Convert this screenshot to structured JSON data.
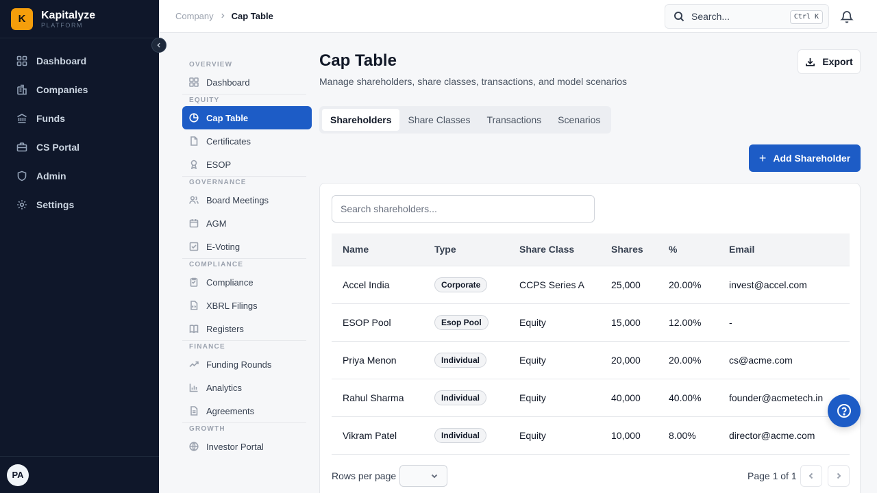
{
  "brand": {
    "logo_letter": "K",
    "name": "Kapitalyze",
    "sub": "PLATFORM"
  },
  "main_nav": [
    {
      "label": "Dashboard",
      "icon": "dashboard-icon"
    },
    {
      "label": "Companies",
      "icon": "building-icon"
    },
    {
      "label": "Funds",
      "icon": "bank-icon"
    },
    {
      "label": "CS Portal",
      "icon": "briefcase-icon"
    },
    {
      "label": "Admin",
      "icon": "shield-icon"
    },
    {
      "label": "Settings",
      "icon": "gear-icon"
    }
  ],
  "user": {
    "initials": "PA"
  },
  "breadcrumb": {
    "parent": "Company",
    "current": "Cap Table"
  },
  "search": {
    "placeholder": "Search...",
    "shortcut": "Ctrl K"
  },
  "subnav": {
    "sections": [
      {
        "title": "OVERVIEW",
        "items": [
          {
            "label": "Dashboard",
            "icon": "grid-icon"
          }
        ]
      },
      {
        "title": "EQUITY",
        "items": [
          {
            "label": "Cap Table",
            "icon": "pie-chart-icon",
            "active": true
          },
          {
            "label": "Certificates",
            "icon": "file-icon"
          },
          {
            "label": "ESOP",
            "icon": "award-icon"
          }
        ]
      },
      {
        "title": "GOVERNANCE",
        "items": [
          {
            "label": "Board Meetings",
            "icon": "users-icon"
          },
          {
            "label": "AGM",
            "icon": "calendar-icon"
          },
          {
            "label": "E-Voting",
            "icon": "vote-icon"
          }
        ]
      },
      {
        "title": "COMPLIANCE",
        "items": [
          {
            "label": "Compliance",
            "icon": "clipboard-icon"
          },
          {
            "label": "XBRL Filings",
            "icon": "file-code-icon"
          },
          {
            "label": "Registers",
            "icon": "book-icon"
          }
        ]
      },
      {
        "title": "FINANCE",
        "items": [
          {
            "label": "Funding Rounds",
            "icon": "trending-up-icon"
          },
          {
            "label": "Analytics",
            "icon": "bar-chart-icon"
          },
          {
            "label": "Agreements",
            "icon": "file-text-icon"
          }
        ]
      },
      {
        "title": "GROWTH",
        "items": [
          {
            "label": "Investor Portal",
            "icon": "globe-icon"
          }
        ]
      }
    ]
  },
  "page": {
    "title": "Cap Table",
    "subtitle": "Manage shareholders, share classes, transactions, and model scenarios",
    "export_label": "Export",
    "add_label": "Add Shareholder"
  },
  "tabs": [
    {
      "label": "Shareholders",
      "active": true
    },
    {
      "label": "Share Classes"
    },
    {
      "label": "Transactions"
    },
    {
      "label": "Scenarios"
    }
  ],
  "table": {
    "search_placeholder": "Search shareholders...",
    "columns": [
      "Name",
      "Type",
      "Share Class",
      "Shares",
      "%",
      "Email"
    ],
    "rows": [
      {
        "name": "Accel India",
        "type": "Corporate",
        "share_class": "CCPS Series A",
        "shares": "25,000",
        "percent": "20.00%",
        "email": "invest@accel.com"
      },
      {
        "name": "ESOP Pool",
        "type": "Esop Pool",
        "share_class": "Equity",
        "shares": "15,000",
        "percent": "12.00%",
        "email": "-"
      },
      {
        "name": "Priya Menon",
        "type": "Individual",
        "share_class": "Equity",
        "shares": "20,000",
        "percent": "20.00%",
        "email": "cs@acme.com"
      },
      {
        "name": "Rahul Sharma",
        "type": "Individual",
        "share_class": "Equity",
        "shares": "40,000",
        "percent": "40.00%",
        "email": "founder@acmetech.in"
      },
      {
        "name": "Vikram Patel",
        "type": "Individual",
        "share_class": "Equity",
        "shares": "10,000",
        "percent": "8.00%",
        "email": "director@acme.com"
      }
    ],
    "rows_per_page_label": "Rows per page",
    "page_info": "Page 1 of 1"
  },
  "colors": {
    "primary": "#1d5cc6",
    "sidebar_bg": "#0f172a",
    "brand_accent": "#f59e0b"
  }
}
